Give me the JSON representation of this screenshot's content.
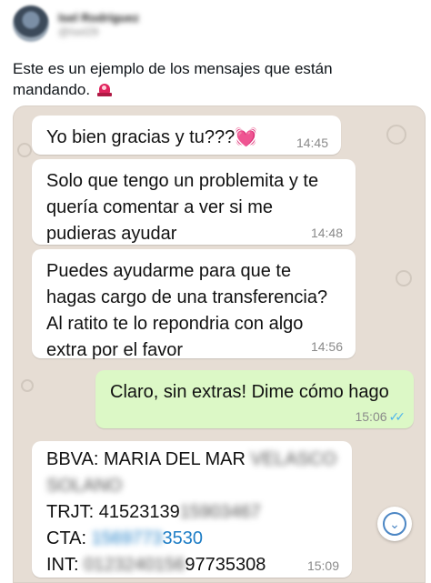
{
  "author": {
    "name": "Isel Rodríguez",
    "handle": "@Isel29"
  },
  "post": {
    "text": "Este es un ejemplo de los mensajes que están mandando."
  },
  "icons": {
    "siren": "siren-icon",
    "heart": "pink-heart-icon",
    "read_receipt": "double-check-icon",
    "scroll_down": "chevron-down-icon"
  },
  "colors": {
    "incoming_bubble": "#ffffff",
    "outgoing_bubble": "#dcf8c6",
    "chat_background": "#e6ddd4",
    "read_check": "#4fb6ec"
  },
  "chat": {
    "messages": [
      {
        "text": "Yo bien gracias y tu???",
        "emoji": "💓",
        "time": "14:45"
      },
      {
        "text": "Solo que tengo un problemita y te quería comentar a ver si me pudieras ayudar",
        "time": "14:48"
      },
      {
        "text": "Puedes ayudarme para que te hagas cargo de una transferencia? Al ratito te lo repondria con algo extra por el favor",
        "time": "14:56"
      },
      {
        "text": "Claro, sin extras! Dime cómo hago",
        "time": "15:06",
        "check": "✓✓"
      }
    ],
    "bank": {
      "line1_prefix": "BBVA: MARIA DEL MAR",
      "line1_blurred": "VELASCO",
      "line2_blurred": "SOLANO",
      "trjt_label": "TRJT: ",
      "trjt_visible": "41523139",
      "trjt_blurred": "15903467",
      "cta_label": "CTA: ",
      "cta_blurred": "1569773",
      "cta_visible": "3530",
      "int_label": "INT: ",
      "int_blurred": "0123240156",
      "int_visible": "97735308",
      "time": "15:09"
    }
  }
}
